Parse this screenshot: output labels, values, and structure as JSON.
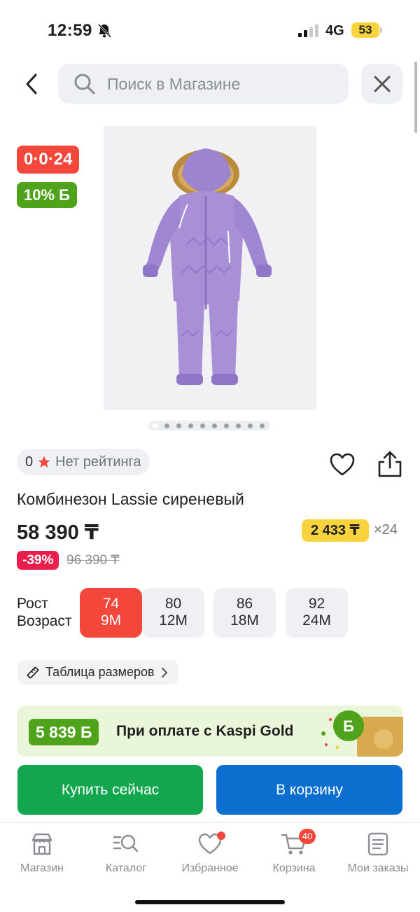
{
  "status_bar": {
    "time": "12:59",
    "network": "4G",
    "battery": "53"
  },
  "search": {
    "placeholder": "Поиск в Магазине"
  },
  "product": {
    "badges": {
      "timer": "0·0·24",
      "bonus": "10% Б"
    },
    "rating_value": "0",
    "rating_text": "Нет рейтинга",
    "title": "Комбинезон Lassie сиреневый",
    "price": "58 390 ₸",
    "installment_price": "2 433 ₸",
    "installment_months": "×24",
    "discount": "-39%",
    "old_price": "96 390 ₸",
    "gallery_total": 10,
    "gallery_active": 0,
    "image_color": "#a88fd6"
  },
  "sizes": {
    "label_height": "Рост",
    "label_age": "Возраст",
    "options": [
      {
        "height": "74",
        "age": "9M",
        "selected": true
      },
      {
        "height": "80",
        "age": "12M",
        "selected": false
      },
      {
        "height": "86",
        "age": "18M",
        "selected": false
      },
      {
        "height": "92",
        "age": "24M",
        "selected": false
      }
    ]
  },
  "size_table_label": "Таблица размеров",
  "kaspi_gold": {
    "bonus": "5 839 Б",
    "text": "При оплате с Kaspi Gold"
  },
  "actions": {
    "buy_now": "Купить сейчас",
    "add_to_cart": "В корзину"
  },
  "tabs": [
    {
      "label": "Магазин",
      "icon": "store-icon"
    },
    {
      "label": "Каталог",
      "icon": "catalog-icon"
    },
    {
      "label": "Избранное",
      "icon": "heart-icon"
    },
    {
      "label": "Корзина",
      "icon": "cart-icon",
      "badge": "40"
    },
    {
      "label": "Мои заказы",
      "icon": "orders-icon"
    }
  ],
  "colors": {
    "accent_red": "#f2473a",
    "kaspi_green": "#4ea31a",
    "buy_green": "#12a64f",
    "cart_blue": "#0c6fcf",
    "installment_yellow": "#f8d33d"
  }
}
